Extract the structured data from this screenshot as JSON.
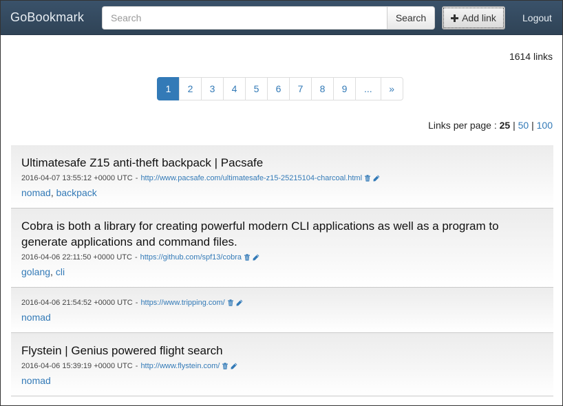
{
  "navbar": {
    "brand": "GoBookmark",
    "search_placeholder": "Search",
    "search_button": "Search",
    "add_link_button": "Add link",
    "logout": "Logout"
  },
  "link_count": "1614 links",
  "pagination": {
    "pages": [
      "1",
      "2",
      "3",
      "4",
      "5",
      "6",
      "7",
      "8",
      "9",
      "...",
      "»"
    ],
    "active": "1"
  },
  "per_page": {
    "label": "Links per page :",
    "options": [
      "25",
      "50",
      "100"
    ],
    "current": "25",
    "separator": "|"
  },
  "links": [
    {
      "title": "Ultimatesafe Z15 anti-theft backpack | Pacsafe",
      "date": "2016-04-07 13:55:12 +0000 UTC",
      "sep": "-",
      "url": "http://www.pacsafe.com/ultimatesafe-z15-25215104-charcoal.html",
      "tags": [
        "nomad",
        "backpack"
      ]
    },
    {
      "title": "Cobra is both a library for creating powerful modern CLI applications as well as a program to generate applications and command files.",
      "date": "2016-04-06 22:11:50 +0000 UTC",
      "sep": "-",
      "url": "https://github.com/spf13/cobra",
      "tags": [
        "golang",
        "cli"
      ]
    },
    {
      "title": "",
      "date": "2016-04-06 21:54:52 +0000 UTC",
      "sep": "-",
      "url": "https://www.tripping.com/",
      "tags": [
        "nomad"
      ]
    },
    {
      "title": "Flystein | Genius powered flight search",
      "date": "2016-04-06 15:39:19 +0000 UTC",
      "sep": "-",
      "url": "http://www.flystein.com/",
      "tags": [
        "nomad"
      ]
    }
  ],
  "colors": {
    "navbar": "#34495e",
    "link": "#337ab7",
    "active_page": "#337ab7"
  },
  "icons": {
    "delete": "trash-icon",
    "edit": "pencil-icon",
    "add": "plus-icon"
  }
}
